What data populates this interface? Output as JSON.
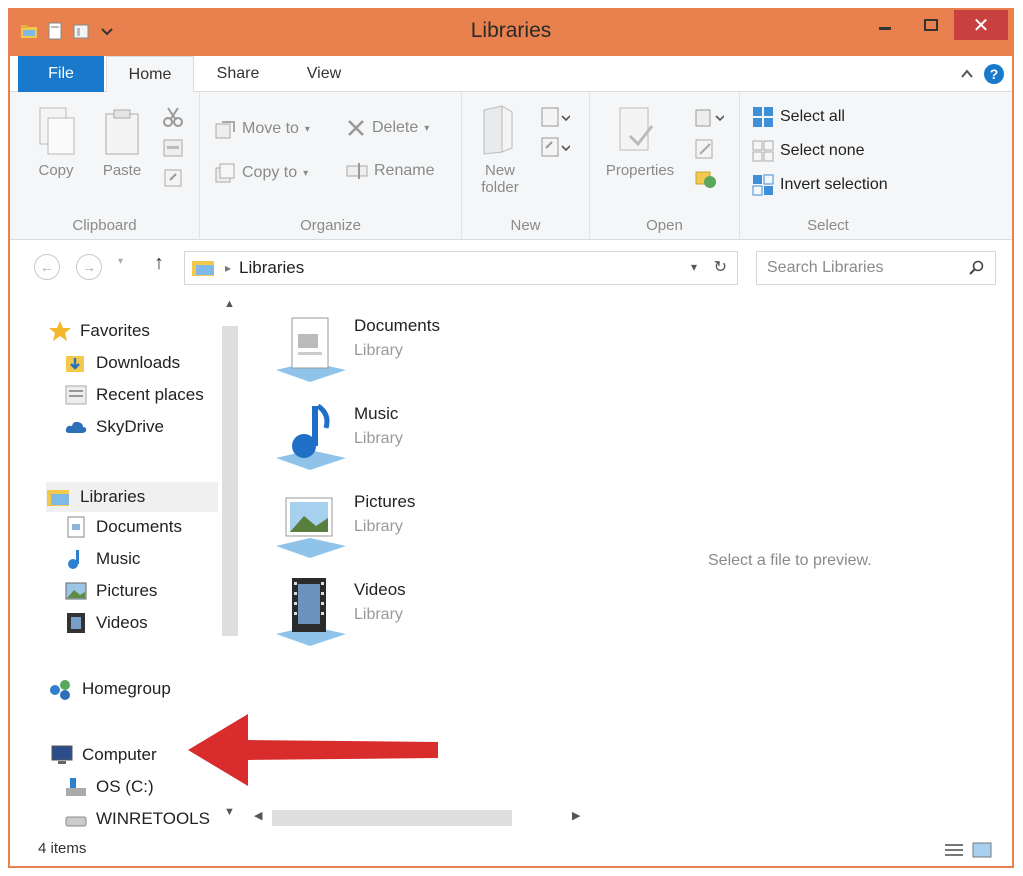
{
  "window": {
    "title": "Libraries"
  },
  "window_controls": {
    "minimize": "—",
    "maximize": "□",
    "close": "✕"
  },
  "ribbon": {
    "tabs": [
      {
        "label": "File",
        "active": false
      },
      {
        "label": "Home",
        "active": true
      },
      {
        "label": "Share",
        "active": false
      },
      {
        "label": "View",
        "active": false
      }
    ],
    "groups": {
      "clipboard": {
        "label": "Clipboard",
        "copy": "Copy",
        "paste": "Paste"
      },
      "organize": {
        "label": "Organize",
        "move_to": "Move to",
        "copy_to": "Copy to",
        "delete": "Delete",
        "rename": "Rename"
      },
      "new": {
        "label": "New",
        "new_folder_line1": "New",
        "new_folder_line2": "folder"
      },
      "open": {
        "label": "Open",
        "properties": "Properties"
      },
      "select": {
        "label": "Select",
        "select_all": "Select all",
        "select_none": "Select none",
        "invert_selection": "Invert selection"
      }
    }
  },
  "nav": {
    "breadcrumb": "Libraries",
    "search_placeholder": "Search Libraries"
  },
  "navpane": {
    "favorites": {
      "label": "Favorites",
      "items": [
        "Downloads",
        "Recent places",
        "SkyDrive"
      ]
    },
    "libraries": {
      "label": "Libraries",
      "items": [
        "Documents",
        "Music",
        "Pictures",
        "Videos"
      ]
    },
    "homegroup": "Homegroup",
    "computer": {
      "label": "Computer",
      "items": [
        "OS (C:)",
        "WINRETOOLS"
      ]
    }
  },
  "content": {
    "libraries": [
      {
        "name": "Documents",
        "type": "Library",
        "icon": "documents-icon"
      },
      {
        "name": "Music",
        "type": "Library",
        "icon": "music-icon"
      },
      {
        "name": "Pictures",
        "type": "Library",
        "icon": "pictures-icon"
      },
      {
        "name": "Videos",
        "type": "Library",
        "icon": "videos-icon"
      }
    ]
  },
  "preview": {
    "message": "Select a file to preview."
  },
  "status": {
    "count": "4 items"
  },
  "colors": {
    "frame": "#e8814d",
    "file_tab": "#1979ca",
    "close": "#c94040",
    "annotation_arrow": "#d92c2c"
  }
}
